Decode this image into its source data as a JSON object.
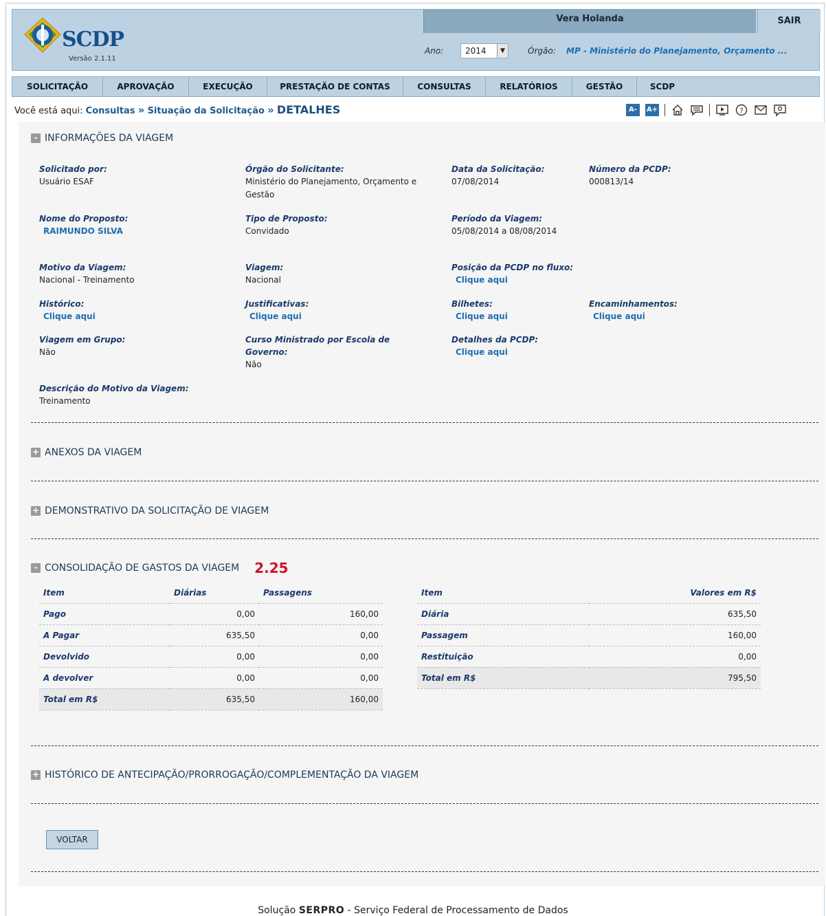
{
  "header": {
    "app_name": "SCDP",
    "version": "Versão 2.1.11",
    "user": "Vera Holanda",
    "logout": "SAIR",
    "ano_label": "Ano:",
    "ano_value": "2014",
    "orgao_label": "Órgão:",
    "orgao_value": "MP - Ministério do Planejamento, Orçamento ..."
  },
  "menu": {
    "items": [
      "SOLICITAÇÃO",
      "APROVAÇÃO",
      "EXECUÇÃO",
      "PRESTAÇÃO DE CONTAS",
      "CONSULTAS",
      "RELATÓRIOS",
      "GESTÃO",
      "SCDP"
    ]
  },
  "breadcrumb": {
    "prefix": "Você está aqui:",
    "items": [
      "Consultas",
      "Situação da Solicitação"
    ],
    "current": "DETALHES"
  },
  "tools": {
    "font_decrease": "A-",
    "font_increase": "A+"
  },
  "sections": {
    "info": "INFORMAÇÕES DA VIAGEM",
    "anexos": "ANEXOS DA VIAGEM",
    "demonstrativo": "DEMONSTRATIVO DA SOLICITAÇÃO DE VIAGEM",
    "consolidacao": "CONSOLIDAÇÃO DE GASTOS DA VIAGEM",
    "consolidacao_code": "2.25",
    "historico": "HISTÓRICO DE ANTECIPAÇÃO/PRORROGAÇÃO/COMPLEMENTAÇÃO DA VIAGEM"
  },
  "info": {
    "solicitado_por": {
      "label": "Solicitado por:",
      "value": "Usuário ESAF"
    },
    "orgao_solicitante": {
      "label": "Órgão do Solicitante:",
      "value1": "Ministério do Planejamento, Orçamento e",
      "value2": "Gestão"
    },
    "data_solicitacao": {
      "label": "Data da Solicitação:",
      "value": "07/08/2014"
    },
    "numero_pcdp": {
      "label": "Número da PCDP:",
      "value": "000813/14"
    },
    "nome_proposto": {
      "label": "Nome do Proposto:",
      "value": "RAIMUNDO SILVA"
    },
    "tipo_proposto": {
      "label": "Tipo de Proposto:",
      "value": "Convidado"
    },
    "periodo_viagem": {
      "label": "Período da Viagem:",
      "value": "05/08/2014 a 08/08/2014"
    },
    "motivo_viagem": {
      "label": "Motivo da Viagem:",
      "value": "Nacional - Treinamento"
    },
    "viagem": {
      "label": "Viagem:",
      "value": "Nacional"
    },
    "posicao_fluxo": {
      "label": "Posição da PCDP no fluxo:",
      "value": "Clique aqui"
    },
    "historico": {
      "label": "Histórico:",
      "value": "Clique aqui"
    },
    "justificativas": {
      "label": "Justificativas:",
      "value": "Clique aqui"
    },
    "bilhetes": {
      "label": "Bilhetes:",
      "value": "Clique aqui"
    },
    "encaminhamentos": {
      "label": "Encaminhamentos:",
      "value": "Clique aqui"
    },
    "viagem_grupo": {
      "label": "Viagem em Grupo:",
      "value": "Não"
    },
    "curso": {
      "label1": "Curso Ministrado por Escola de",
      "label2": "Governo:",
      "value": "Não"
    },
    "detalhes_pcdp": {
      "label": "Detalhes da PCDP:",
      "value": "Clique aqui"
    },
    "descricao_motivo": {
      "label": "Descrição do Motivo da Viagem:",
      "value": "Treinamento"
    }
  },
  "table1": {
    "headers": [
      "Item",
      "Diárias",
      "Passagens"
    ],
    "rows": [
      [
        "Pago",
        "0,00",
        "160,00"
      ],
      [
        "A Pagar",
        "635,50",
        "0,00"
      ],
      [
        "Devolvido",
        "0,00",
        "0,00"
      ],
      [
        "A devolver",
        "0,00",
        "0,00"
      ],
      [
        "Total em R$",
        "635,50",
        "160,00"
      ]
    ]
  },
  "table2": {
    "headers": [
      "Item",
      "Valores em R$"
    ],
    "rows": [
      [
        "Diária",
        "635,50"
      ],
      [
        "Passagem",
        "160,00"
      ],
      [
        "Restituição",
        "0,00"
      ],
      [
        "Total em R$",
        "795,50"
      ]
    ]
  },
  "buttons": {
    "voltar": "VOLTAR"
  },
  "footer": {
    "prefix": "Solução",
    "brand": "SERPRO",
    "suffix": "- Serviço Federal de Processamento de Dados"
  }
}
